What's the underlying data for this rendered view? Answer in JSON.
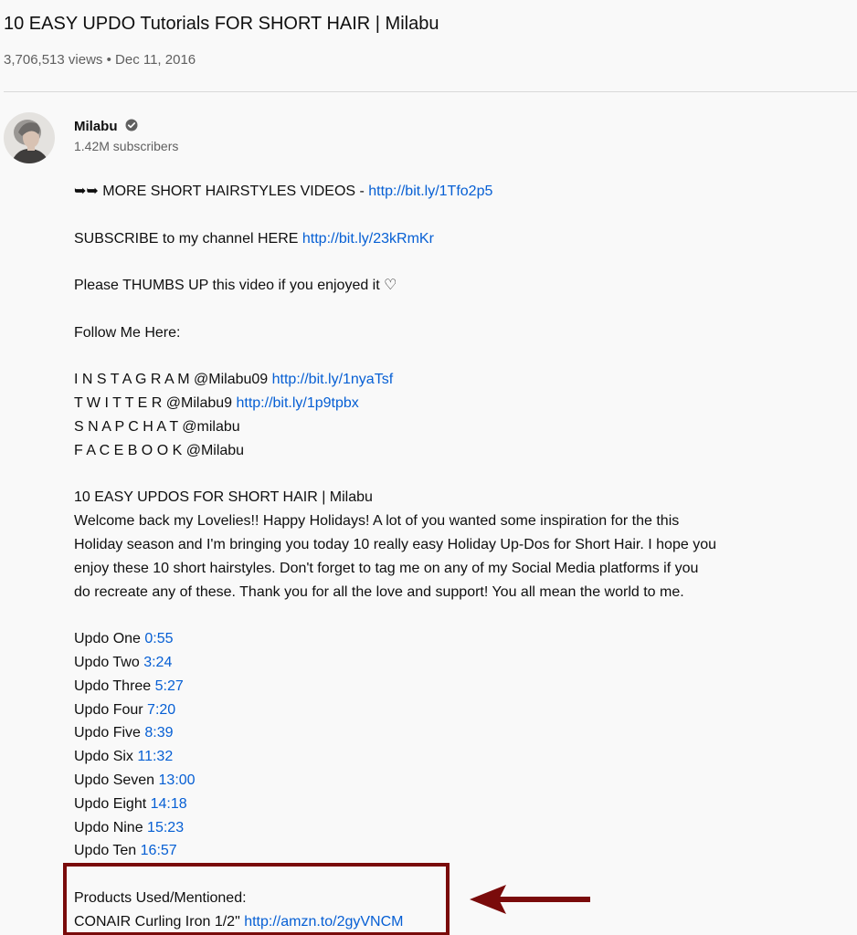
{
  "video": {
    "title": "10 EASY UPDO Tutorials FOR SHORT HAIR | Milabu",
    "views": "3,706,513 views",
    "separator": "•",
    "date": "Dec 11, 2016"
  },
  "channel": {
    "name": "Milabu",
    "subscribers": "1.42M subscribers",
    "verified_icon": "verified-check-icon"
  },
  "description": {
    "more_prefix": "➥➥  MORE  SHORT HAIRSTYLES  VIDEOS  -  ",
    "more_link": "http://bit.ly/1Tfo2p5",
    "subscribe_text": "SUBSCRIBE to my channel HERE ",
    "subscribe_link": "http://bit.ly/23kRmKr",
    "thumbs": "Please THUMBS UP this video if you enjoyed it ♡",
    "follow": "Follow Me Here:",
    "instagram_text": "I N S T A G R A M @Milabu09 ",
    "instagram_link": "http://bit.ly/1nyaTsf",
    "twitter_text": "T W I T T E R @Milabu9 ",
    "twitter_link": "http://bit.ly/1p9tpbx",
    "snapchat": "S N A P C H A T @milabu",
    "facebook": "F A C E B O O K @Milabu",
    "heading": "10 EASY UPDOS FOR SHORT HAIR | Milabu",
    "para": [
      "Welcome back my Lovelies!! Happy Holidays! A lot of you wanted some inspiration for the this",
      "Holiday season and I'm bringing you today 10 really easy Holiday Up-Dos for Short Hair. I hope you",
      "enjoy these 10 short hairstyles. Don't forget to tag me on any of my Social Media platforms if you",
      "do recreate any of these. Thank you for all the love and support! You all mean the world to me."
    ],
    "updos": [
      {
        "label": "Updo One ",
        "time": "0:55"
      },
      {
        "label": "Updo Two ",
        "time": "3:24"
      },
      {
        "label": "Updo Three ",
        "time": "5:27"
      },
      {
        "label": "Updo Four ",
        "time": "7:20"
      },
      {
        "label": "Updo Five ",
        "time": "8:39"
      },
      {
        "label": "Updo Six ",
        "time": "11:32"
      },
      {
        "label": "Updo Seven ",
        "time": "13:00"
      },
      {
        "label": "Updo Eight ",
        "time": "14:18"
      },
      {
        "label": "Updo Nine ",
        "time": "15:23"
      },
      {
        "label": "Updo Ten ",
        "time": "16:57"
      }
    ],
    "products_heading": "Products Used/Mentioned:",
    "product_text": "CONAIR Curling Iron 1/2\" ",
    "product_link": "http://amzn.to/2gyVNCM"
  },
  "colors": {
    "link": "#065fd4",
    "annotation": "#7a0b0b"
  }
}
